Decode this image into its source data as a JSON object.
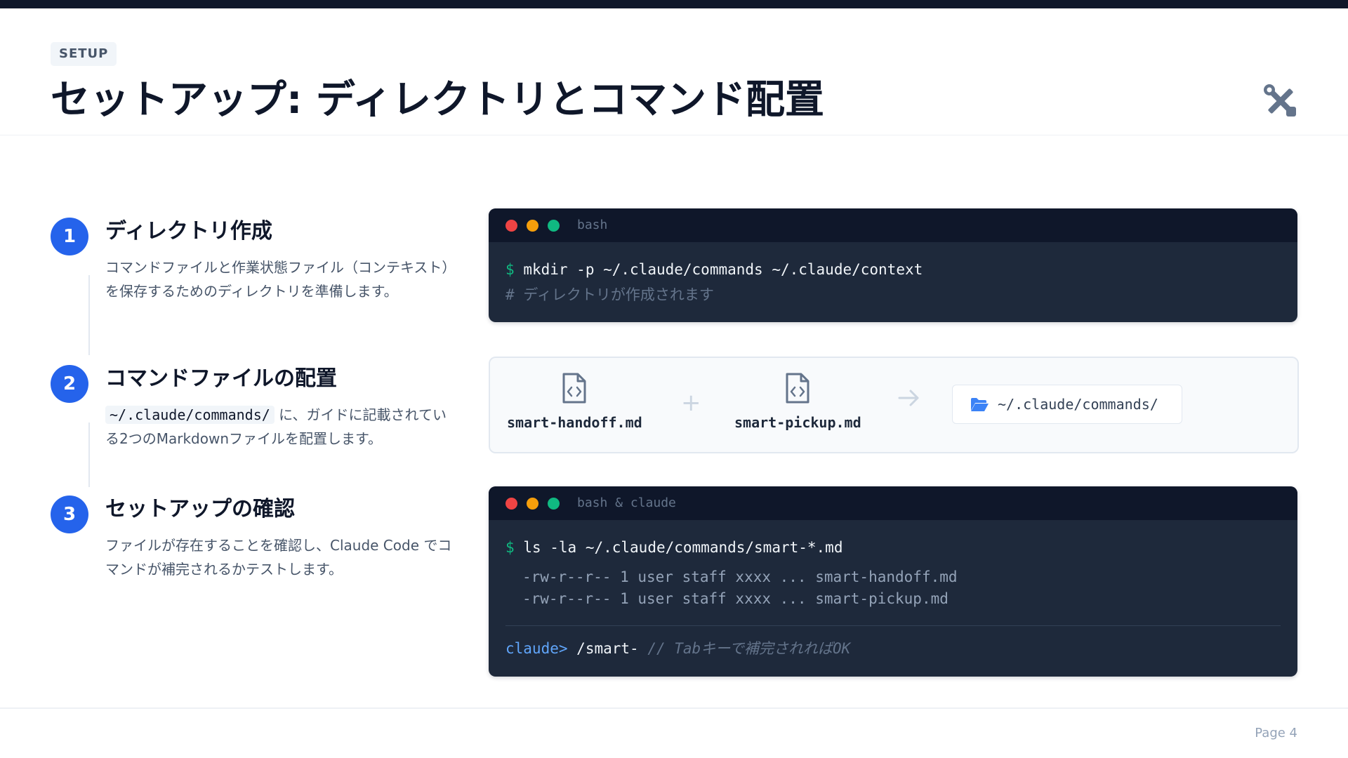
{
  "header": {
    "tag": "SETUP",
    "title": "セットアップ: ディレクトリとコマンド配置",
    "icon": "tools-icon"
  },
  "steps": [
    {
      "number": "1",
      "title": "ディレクトリ作成",
      "desc": "コマンドファイルと作業状態ファイル（コンテキスト）を保存するためのディレクトリを準備します。"
    },
    {
      "number": "2",
      "title": "コマンドファイルの配置",
      "code": "~/.claude/commands/",
      "desc": " に、ガイドに記載されている2つのMarkdownファイルを配置します。"
    },
    {
      "number": "3",
      "title": "セットアップの確認",
      "desc": "ファイルが存在することを確認し、Claude Code でコマンドが補完されるかテストします。"
    }
  ],
  "terminal1": {
    "label": "bash",
    "prompt": "$",
    "command": "mkdir -p ~/.claude/commands ~/.claude/context",
    "comment": "# ディレクトリが作成されます"
  },
  "files": {
    "file1": "smart-handoff.md",
    "file2": "smart-pickup.md",
    "plus": "+",
    "destination": "~/.claude/commands/"
  },
  "terminal2": {
    "label": "bash & claude",
    "prompt": "$",
    "command": "ls -la ~/.claude/commands/smart-*.md",
    "output1": "-rw-r--r-- 1 user staff xxxx ... smart-handoff.md",
    "output2": "-rw-r--r-- 1 user staff xxxx ... smart-pickup.md",
    "claude_prompt": "claude>",
    "claude_command": "/smart-",
    "claude_comment": "// Tabキーで補完されればOK"
  },
  "footer": {
    "page": "Page 4"
  },
  "colors": {
    "accent": "#2563eb",
    "dark": "#0f172a",
    "terminal_bg": "#1e293b",
    "dot_red": "#ef4444",
    "dot_yellow": "#f59e0b",
    "dot_green": "#10b981"
  }
}
